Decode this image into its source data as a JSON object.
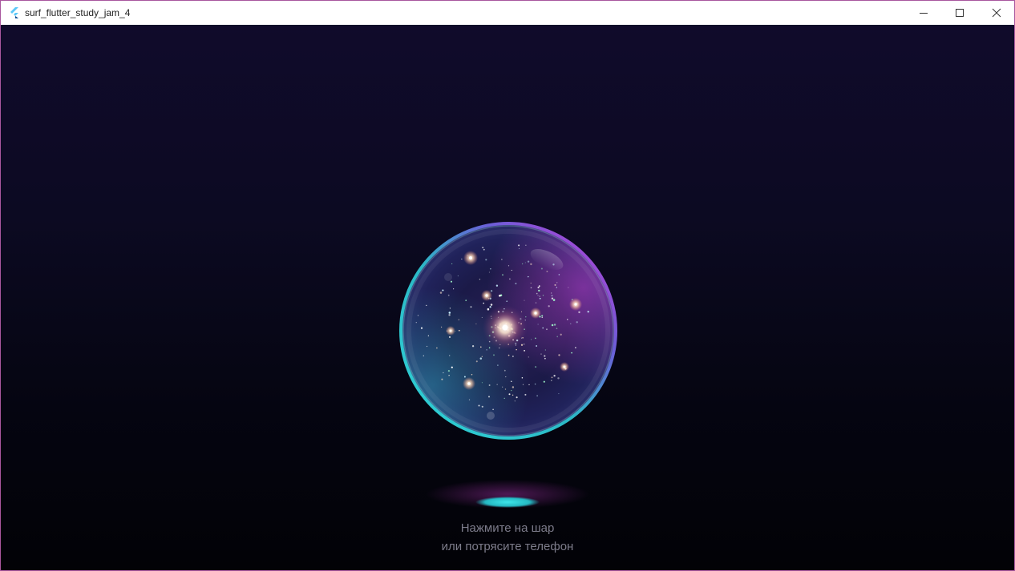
{
  "window": {
    "title": "surf_flutter_study_jam_4",
    "icons": {
      "app": "flutter-logo-icon",
      "minimize": "minimize-icon",
      "maximize": "maximize-icon",
      "close": "close-icon"
    }
  },
  "main": {
    "hint_line_1": "Нажмите на шар",
    "hint_line_2": "или потрясите телефон"
  },
  "colors": {
    "background_top": "#100b2b",
    "background_bottom": "#020206",
    "orb_rim_cyan": "#2fd3d6",
    "orb_rim_magenta": "#b23ad0",
    "shadow_cyan": "#2fd4d8",
    "shadow_magenta": "#8a2a8f",
    "hint_text": "#7d7c8b"
  }
}
